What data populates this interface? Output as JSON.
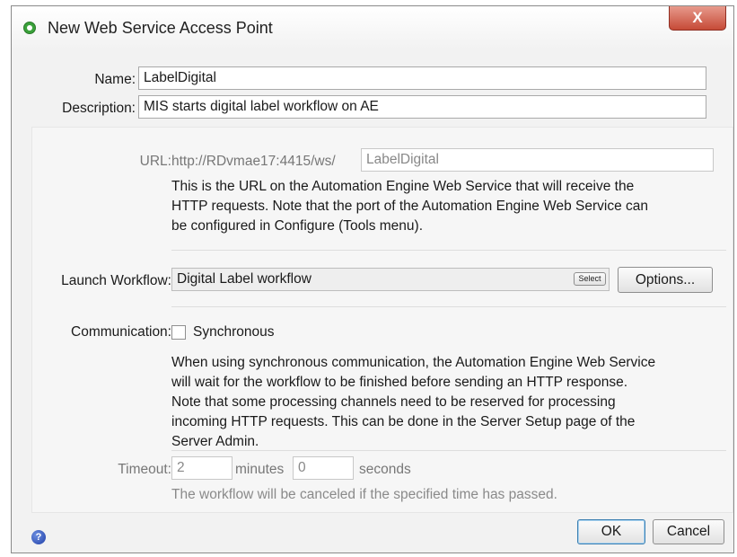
{
  "window": {
    "title": "New Web Service Access Point",
    "close_symbol": "X"
  },
  "form": {
    "name_label": "Name:",
    "name_value": "LabelDigital",
    "description_label": "Description:",
    "description_value": "MIS starts digital label workflow on AE"
  },
  "url": {
    "label": "URL:",
    "prefix": "http://RDvmae17:4415/ws/",
    "value": "LabelDigital",
    "help_lines": [
      "This is the URL on the Automation Engine Web Service that will receive the",
      "HTTP requests. Note that the port of the Automation Engine Web Service can",
      "be configured in Configure (Tools menu)."
    ]
  },
  "workflow": {
    "label": "Launch Workflow:",
    "value": "Digital Label workflow",
    "select_label": "Select",
    "options_label": "Options..."
  },
  "communication": {
    "label": "Communication:",
    "checkbox_label": "Synchronous",
    "checked": false,
    "help_lines": [
      "When using synchronous communication, the Automation Engine Web Service",
      "will wait for the workflow to be finished before sending an HTTP response.",
      "Note that some processing channels need to be reserved for processing",
      "incoming HTTP requests. This can be done in the Server Setup page of the",
      "Server Admin."
    ]
  },
  "timeout": {
    "label": "Timeout:",
    "minutes_value": "2",
    "minutes_unit": "minutes",
    "seconds_value": "0",
    "seconds_unit": "seconds",
    "help": "The workflow will be canceled if the specified time has passed."
  },
  "footer": {
    "help_symbol": "?",
    "ok_label": "OK",
    "cancel_label": "Cancel"
  },
  "icons": {
    "title": "green-circle-icon",
    "close": "close-icon",
    "help": "help-icon"
  },
  "colors": {
    "close_button": "#c64a37",
    "dialog_background": "#f2f2f2",
    "ok_focus": "#3c7fb1"
  }
}
